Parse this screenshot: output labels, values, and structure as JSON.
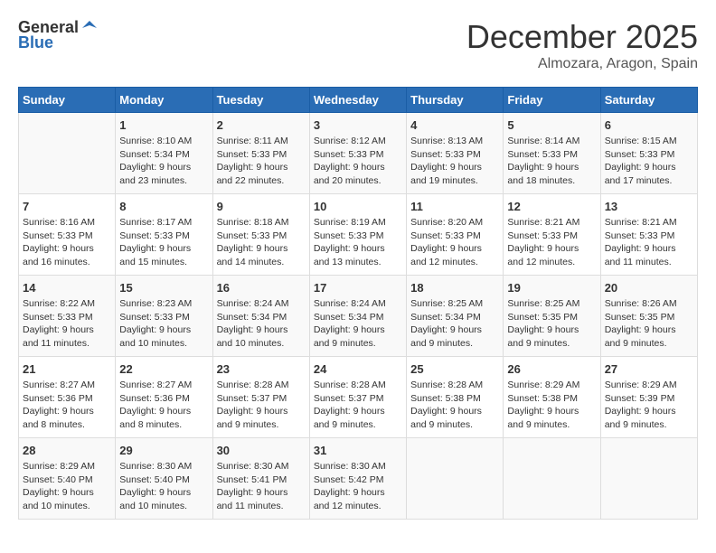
{
  "header": {
    "logo_general": "General",
    "logo_blue": "Blue",
    "month": "December 2025",
    "location": "Almozara, Aragon, Spain"
  },
  "weekdays": [
    "Sunday",
    "Monday",
    "Tuesday",
    "Wednesday",
    "Thursday",
    "Friday",
    "Saturday"
  ],
  "weeks": [
    [
      {
        "day": "",
        "info": ""
      },
      {
        "day": "1",
        "info": "Sunrise: 8:10 AM\nSunset: 5:34 PM\nDaylight: 9 hours\nand 23 minutes."
      },
      {
        "day": "2",
        "info": "Sunrise: 8:11 AM\nSunset: 5:33 PM\nDaylight: 9 hours\nand 22 minutes."
      },
      {
        "day": "3",
        "info": "Sunrise: 8:12 AM\nSunset: 5:33 PM\nDaylight: 9 hours\nand 20 minutes."
      },
      {
        "day": "4",
        "info": "Sunrise: 8:13 AM\nSunset: 5:33 PM\nDaylight: 9 hours\nand 19 minutes."
      },
      {
        "day": "5",
        "info": "Sunrise: 8:14 AM\nSunset: 5:33 PM\nDaylight: 9 hours\nand 18 minutes."
      },
      {
        "day": "6",
        "info": "Sunrise: 8:15 AM\nSunset: 5:33 PM\nDaylight: 9 hours\nand 17 minutes."
      }
    ],
    [
      {
        "day": "7",
        "info": "Sunrise: 8:16 AM\nSunset: 5:33 PM\nDaylight: 9 hours\nand 16 minutes."
      },
      {
        "day": "8",
        "info": "Sunrise: 8:17 AM\nSunset: 5:33 PM\nDaylight: 9 hours\nand 15 minutes."
      },
      {
        "day": "9",
        "info": "Sunrise: 8:18 AM\nSunset: 5:33 PM\nDaylight: 9 hours\nand 14 minutes."
      },
      {
        "day": "10",
        "info": "Sunrise: 8:19 AM\nSunset: 5:33 PM\nDaylight: 9 hours\nand 13 minutes."
      },
      {
        "day": "11",
        "info": "Sunrise: 8:20 AM\nSunset: 5:33 PM\nDaylight: 9 hours\nand 12 minutes."
      },
      {
        "day": "12",
        "info": "Sunrise: 8:21 AM\nSunset: 5:33 PM\nDaylight: 9 hours\nand 12 minutes."
      },
      {
        "day": "13",
        "info": "Sunrise: 8:21 AM\nSunset: 5:33 PM\nDaylight: 9 hours\nand 11 minutes."
      }
    ],
    [
      {
        "day": "14",
        "info": "Sunrise: 8:22 AM\nSunset: 5:33 PM\nDaylight: 9 hours\nand 11 minutes."
      },
      {
        "day": "15",
        "info": "Sunrise: 8:23 AM\nSunset: 5:33 PM\nDaylight: 9 hours\nand 10 minutes."
      },
      {
        "day": "16",
        "info": "Sunrise: 8:24 AM\nSunset: 5:34 PM\nDaylight: 9 hours\nand 10 minutes."
      },
      {
        "day": "17",
        "info": "Sunrise: 8:24 AM\nSunset: 5:34 PM\nDaylight: 9 hours\nand 9 minutes."
      },
      {
        "day": "18",
        "info": "Sunrise: 8:25 AM\nSunset: 5:34 PM\nDaylight: 9 hours\nand 9 minutes."
      },
      {
        "day": "19",
        "info": "Sunrise: 8:25 AM\nSunset: 5:35 PM\nDaylight: 9 hours\nand 9 minutes."
      },
      {
        "day": "20",
        "info": "Sunrise: 8:26 AM\nSunset: 5:35 PM\nDaylight: 9 hours\nand 9 minutes."
      }
    ],
    [
      {
        "day": "21",
        "info": "Sunrise: 8:27 AM\nSunset: 5:36 PM\nDaylight: 9 hours\nand 8 minutes."
      },
      {
        "day": "22",
        "info": "Sunrise: 8:27 AM\nSunset: 5:36 PM\nDaylight: 9 hours\nand 8 minutes."
      },
      {
        "day": "23",
        "info": "Sunrise: 8:28 AM\nSunset: 5:37 PM\nDaylight: 9 hours\nand 9 minutes."
      },
      {
        "day": "24",
        "info": "Sunrise: 8:28 AM\nSunset: 5:37 PM\nDaylight: 9 hours\nand 9 minutes."
      },
      {
        "day": "25",
        "info": "Sunrise: 8:28 AM\nSunset: 5:38 PM\nDaylight: 9 hours\nand 9 minutes."
      },
      {
        "day": "26",
        "info": "Sunrise: 8:29 AM\nSunset: 5:38 PM\nDaylight: 9 hours\nand 9 minutes."
      },
      {
        "day": "27",
        "info": "Sunrise: 8:29 AM\nSunset: 5:39 PM\nDaylight: 9 hours\nand 9 minutes."
      }
    ],
    [
      {
        "day": "28",
        "info": "Sunrise: 8:29 AM\nSunset: 5:40 PM\nDaylight: 9 hours\nand 10 minutes."
      },
      {
        "day": "29",
        "info": "Sunrise: 8:30 AM\nSunset: 5:40 PM\nDaylight: 9 hours\nand 10 minutes."
      },
      {
        "day": "30",
        "info": "Sunrise: 8:30 AM\nSunset: 5:41 PM\nDaylight: 9 hours\nand 11 minutes."
      },
      {
        "day": "31",
        "info": "Sunrise: 8:30 AM\nSunset: 5:42 PM\nDaylight: 9 hours\nand 12 minutes."
      },
      {
        "day": "",
        "info": ""
      },
      {
        "day": "",
        "info": ""
      },
      {
        "day": "",
        "info": ""
      }
    ]
  ]
}
